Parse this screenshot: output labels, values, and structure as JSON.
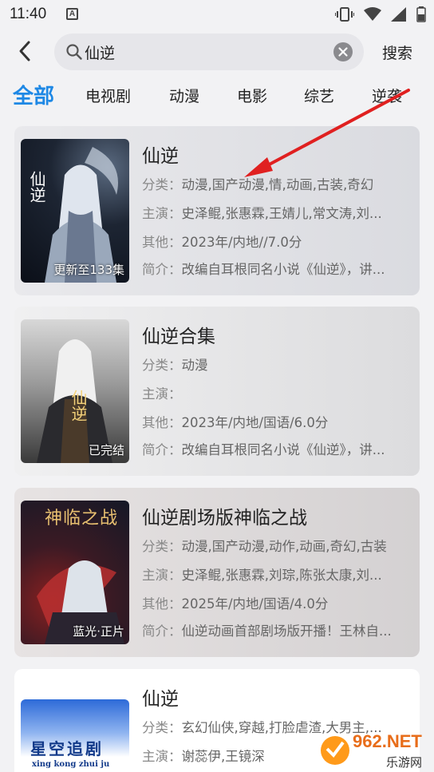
{
  "status": {
    "time": "11:40",
    "notif_glyph": "A"
  },
  "search": {
    "query": "仙逆",
    "button_label": "搜索"
  },
  "tabs": [
    "全部",
    "电视剧",
    "动漫",
    "电影",
    "综艺",
    "逆袭"
  ],
  "results": [
    {
      "title": "仙逆",
      "poster_label": "更新至133集",
      "category_label": "分类：",
      "category": "动漫,国产动漫,情,动画,古装,奇幻",
      "cast_label": "主演：",
      "cast": "史泽鲲,张惠霖,王婧儿,常文涛,刘...",
      "other_label": "其他：",
      "other": "2023年/内地//7.0分",
      "intro_label": "简介：",
      "intro": "改编自耳根同名小说《仙逆》，讲...",
      "poster_text": "仙逆"
    },
    {
      "title": "仙逆合集",
      "poster_label": "已完结",
      "category_label": "分类：",
      "category": "动漫",
      "cast_label": "主演：",
      "cast": "",
      "other_label": "其他：",
      "other": "2023年/内地/国语/6.0分",
      "intro_label": "简介：",
      "intro": "改编自耳根同名小说《仙逆》，讲...",
      "poster_text": "仙逆"
    },
    {
      "title": "仙逆剧场版神临之战",
      "poster_label": "蓝光·正片",
      "category_label": "分类：",
      "category": "动漫,国产动漫,动作,动画,奇幻,古装",
      "cast_label": "主演：",
      "cast": "史泽鲲,张惠霖,刘琮,陈张太康,刘...",
      "other_label": "其他：",
      "other": "2025年/内地/国语/4.0分",
      "intro_label": "简介：",
      "intro": "仙逆动画首部剧场版开播！王林自...",
      "poster_text": "神临之战"
    },
    {
      "title": "仙逆",
      "category_label": "分类：",
      "category": "玄幻仙侠,穿越,打脸虐渣,大男主,...",
      "cast_label": "主演：",
      "cast": "谢蕊伊,王镜深",
      "poster_text": "星空追剧",
      "poster_sub": "xing kong zhui ju"
    }
  ],
  "watermark": {
    "brand": "962.NET",
    "sub": "乐游网"
  },
  "colors": {
    "accent": "#1e88e5",
    "arrow": "#e02020"
  }
}
